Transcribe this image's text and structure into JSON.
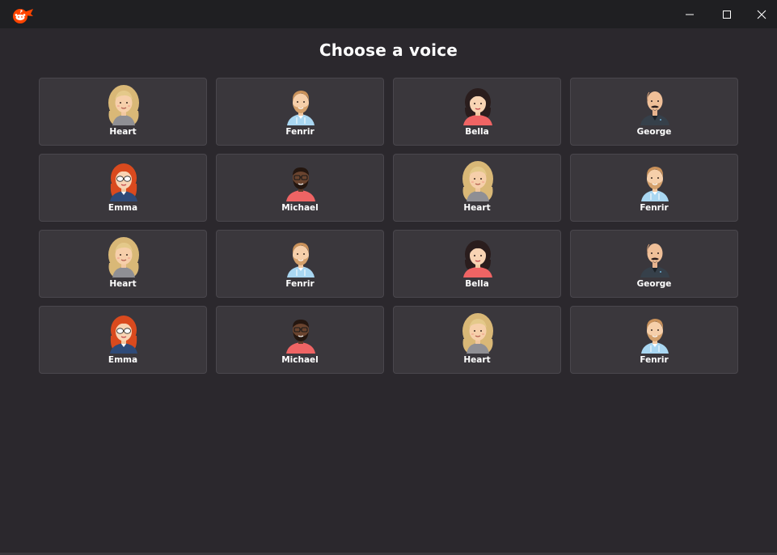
{
  "window": {
    "app_icon": "reddit-alien-logo-icon",
    "controls": {
      "minimize": "minimize-icon",
      "maximize": "maximize-icon",
      "close": "close-icon"
    }
  },
  "page": {
    "title": "Choose a voice"
  },
  "voices": [
    {
      "label": "Heart",
      "avatar": "heart"
    },
    {
      "label": "Fenrir",
      "avatar": "fenrir"
    },
    {
      "label": "Bella",
      "avatar": "bella"
    },
    {
      "label": "George",
      "avatar": "george"
    },
    {
      "label": "Emma",
      "avatar": "emma"
    },
    {
      "label": "Michael",
      "avatar": "michael"
    },
    {
      "label": "Heart",
      "avatar": "heart"
    },
    {
      "label": "Fenrir",
      "avatar": "fenrir"
    },
    {
      "label": "Heart",
      "avatar": "heart"
    },
    {
      "label": "Fenrir",
      "avatar": "fenrir"
    },
    {
      "label": "Bella",
      "avatar": "bella"
    },
    {
      "label": "George",
      "avatar": "george"
    },
    {
      "label": "Emma",
      "avatar": "emma"
    },
    {
      "label": "Michael",
      "avatar": "michael"
    },
    {
      "label": "Heart",
      "avatar": "heart"
    },
    {
      "label": "Fenrir",
      "avatar": "fenrir"
    }
  ],
  "colors": {
    "background": "#2b282d",
    "titlebar": "#1f1f22",
    "card": "#3a373c",
    "accent_logo": "#ff4500"
  }
}
